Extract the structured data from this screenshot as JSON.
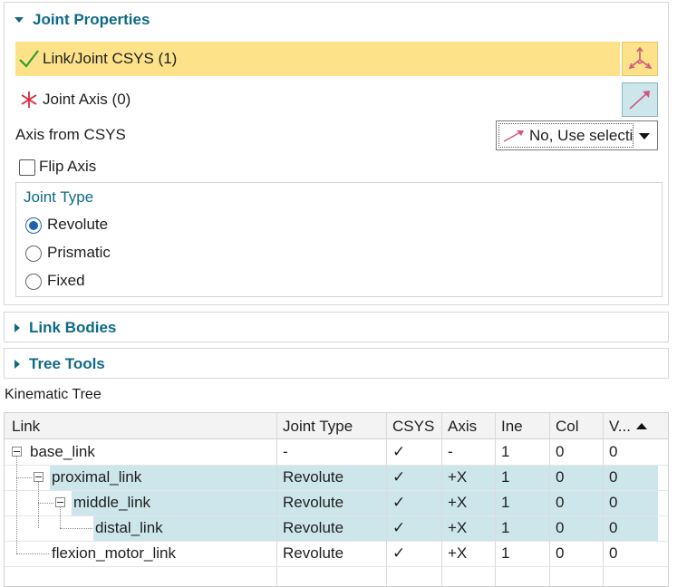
{
  "joint_properties": {
    "title": "Joint Properties",
    "link_csys_label": "Link/Joint CSYS (1)",
    "joint_axis_label": "Joint Axis (0)",
    "axis_from_csys_label": "Axis from CSYS",
    "axis_from_csys_value": "No, Use selecti",
    "flip_axis_label": "Flip Axis",
    "flip_axis_checked": false,
    "joint_type": {
      "title": "Joint Type",
      "options": [
        "Revolute",
        "Prismatic",
        "Fixed"
      ],
      "selected": "Revolute"
    }
  },
  "link_bodies": {
    "title": "Link Bodies"
  },
  "tree_tools": {
    "title": "Tree Tools"
  },
  "kinematic_tree": {
    "title": "Kinematic Tree",
    "columns": [
      "Link",
      "Joint Type",
      "CSYS",
      "Axis",
      "Ine",
      "Col",
      "V..."
    ],
    "sort_column": "V...",
    "rows": [
      {
        "link": "base_link",
        "joint_type": "-",
        "csys": "✓",
        "axis": "-",
        "ine": "1",
        "col": "0",
        "v": "0",
        "selected": false
      },
      {
        "link": "proximal_link",
        "joint_type": "Revolute",
        "csys": "✓",
        "axis": "+X",
        "ine": "1",
        "col": "0",
        "v": "0",
        "selected": true
      },
      {
        "link": "middle_link",
        "joint_type": "Revolute",
        "csys": "✓",
        "axis": "+X",
        "ine": "1",
        "col": "0",
        "v": "0",
        "selected": true
      },
      {
        "link": "distal_link",
        "joint_type": "Revolute",
        "csys": "✓",
        "axis": "+X",
        "ine": "1",
        "col": "0",
        "v": "0",
        "selected": true
      },
      {
        "link": "flexion_motor_link",
        "joint_type": "Revolute",
        "csys": "✓",
        "axis": "+X",
        "ine": "1",
        "col": "0",
        "v": "0",
        "selected": false
      }
    ]
  },
  "colors": {
    "accent": "#0f6a86",
    "highlight_yellow": "#fde28a",
    "selection_blue": "#cde6ec",
    "check_green": "#2e9e2e",
    "error_red": "#d92a3a"
  },
  "icons": {
    "csys_status": "check-icon",
    "axis_status": "asterisk-icon",
    "csys_button": "csys-axes-icon",
    "axis_button": "vector-arrow-icon"
  }
}
